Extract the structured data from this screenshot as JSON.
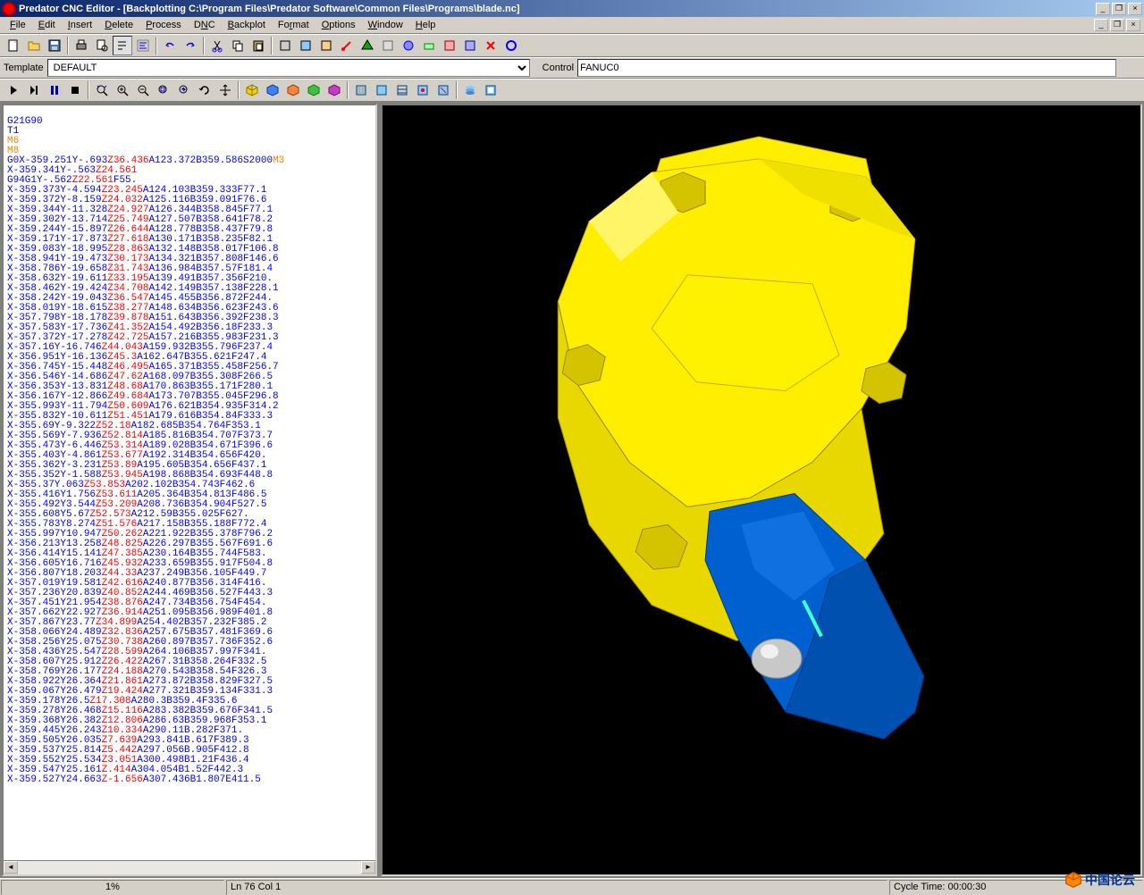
{
  "title": "Predator CNC Editor - [Backplotting C:\\Program Files\\Predator Software\\Common Files\\Programs\\blade.nc]",
  "menu": {
    "file": "File",
    "edit": "Edit",
    "insert": "Insert",
    "delete": "Delete",
    "process": "Process",
    "dnc": "DNC",
    "backplot": "Backplot",
    "format": "Format",
    "options": "Options",
    "window": "Window",
    "help": "Help"
  },
  "template_label": "Template",
  "template_value": "DEFAULT",
  "control_label": "Control",
  "control_value": "FANUC0",
  "status": {
    "progress": "1%",
    "position": "Ln 76 Col 1",
    "cycle": "Cycle Time:  00:00:30"
  },
  "code": {
    "l1": "G21G90",
    "l2": "T1",
    "l3": "M6",
    "l4": "M8",
    "l5a": "G0X-359.251Y-.693",
    "l5b": "Z36.436",
    "l5c": "A123.372B359.586S2000",
    "l5d": "M3",
    "l6a": "X-359.341Y-.563",
    "l6b": "Z24.561",
    "l7a": "G94G1Y-.562",
    "l7b": "Z22.561",
    "l7c": "F55.",
    "l8a": "X-359.373Y-4.594",
    "l8b": "Z23.245",
    "l8c": "A124.103B359.333F77.1",
    "l9a": "X-359.372Y-8.159",
    "l9b": "Z24.032",
    "l9c": "A125.116B359.091F76.6",
    "l10a": "X-359.344Y-11.328",
    "l10b": "Z24.927",
    "l10c": "A126.344B358.845F77.1",
    "l11a": "X-359.302Y-13.714",
    "l11b": "Z25.749",
    "l11c": "A127.507B358.641F78.2",
    "l12a": "X-359.244Y-15.897",
    "l12b": "Z26.644",
    "l12c": "A128.778B358.437F79.8",
    "l13a": "X-359.171Y-17.873",
    "l13b": "Z27.618",
    "l13c": "A130.171B358.235F82.1",
    "l14a": "X-359.083Y-18.995",
    "l14b": "Z28.863",
    "l14c": "A132.148B358.017F106.8",
    "l15a": "X-358.941Y-19.473",
    "l15b": "Z30.173",
    "l15c": "A134.321B357.808F146.6",
    "l16a": "X-358.786Y-19.658",
    "l16b": "Z31.743",
    "l16c": "A136.984B357.57F181.4",
    "l17a": "X-358.632Y-19.611",
    "l17b": "Z33.195",
    "l17c": "A139.491B357.356F210.",
    "l18a": "X-358.462Y-19.424",
    "l18b": "Z34.708",
    "l18c": "A142.149B357.138F228.1",
    "l19a": "X-358.242Y-19.043",
    "l19b": "Z36.547",
    "l19c": "A145.455B356.872F244.",
    "l20a": "X-358.019Y-18.615",
    "l20b": "Z38.277",
    "l20c": "A148.634B356.623F243.6",
    "l21a": "X-357.798Y-18.178",
    "l21b": "Z39.878",
    "l21c": "A151.643B356.392F238.3",
    "l22a": "X-357.583Y-17.736",
    "l22b": "Z41.352",
    "l22c": "A154.492B356.18F233.3",
    "l23a": "X-357.372Y-17.278",
    "l23b": "Z42.725",
    "l23c": "A157.216B355.983F231.3",
    "l24a": "X-357.16Y-16.746",
    "l24b": "Z44.043",
    "l24c": "A159.932B355.796F237.4",
    "l25a": "X-356.951Y-16.136",
    "l25b": "Z45.3",
    "l25c": "A162.647B355.621F247.4",
    "l26a": "X-356.745Y-15.448",
    "l26b": "Z46.495",
    "l26c": "A165.371B355.458F256.7",
    "l27a": "X-356.546Y-14.686",
    "l27b": "Z47.62",
    "l27c": "A168.097B355.308F266.5",
    "l28a": "X-356.353Y-13.831",
    "l28b": "Z48.68",
    "l28c": "A170.863B355.171F280.1",
    "l29a": "X-356.167Y-12.866",
    "l29b": "Z49.684",
    "l29c": "A173.707B355.045F296.8",
    "l30a": "X-355.993Y-11.794",
    "l30b": "Z50.609",
    "l30c": "A176.621B354.935F314.2",
    "l31a": "X-355.832Y-10.611",
    "l31b": "Z51.451",
    "l31c": "A179.616B354.84F333.3",
    "l32a": "X-355.69Y-9.322",
    "l32b": "Z52.18",
    "l32c": "A182.685B354.764F353.1",
    "l33a": "X-355.569Y-7.936",
    "l33b": "Z52.814",
    "l33c": "A185.816B354.707F373.7",
    "l34a": "X-355.473Y-6.446",
    "l34b": "Z53.314",
    "l34c": "A189.028B354.671F396.6",
    "l35a": "X-355.403Y-4.861",
    "l35b": "Z53.677",
    "l35c": "A192.314B354.656F420.",
    "l36a": "X-355.362Y-3.231",
    "l36b": "Z53.89",
    "l36c": "A195.605B354.656F437.1",
    "l37a": "X-355.352Y-1.588",
    "l37b": "Z53.945",
    "l37c": "A198.868B354.693F448.8",
    "l38a": "X-355.37Y.063",
    "l38b": "Z53.853",
    "l38c": "A202.102B354.743F462.6",
    "l39a": "X-355.416Y1.756",
    "l39b": "Z53.611",
    "l39c": "A205.364B354.813F486.5",
    "l40a": "X-355.492Y3.544",
    "l40b": "Z53.209",
    "l40c": "A208.736B354.904F527.5",
    "l41a": "X-355.608Y5.67",
    "l41b": "Z52.573",
    "l41c": "A212.59B355.025F627.",
    "l42a": "X-355.783Y8.274",
    "l42b": "Z51.576",
    "l42c": "A217.158B355.188F772.4",
    "l43a": "X-355.997Y10.947",
    "l43b": "Z50.262",
    "l43c": "A221.922B355.378F796.2",
    "l44a": "X-356.213Y13.258",
    "l44b": "Z48.825",
    "l44c": "A226.297B355.567F691.6",
    "l45a": "X-356.414Y15.141",
    "l45b": "Z47.385",
    "l45c": "A230.164B355.744F583.",
    "l46a": "X-356.605Y16.716",
    "l46b": "Z45.932",
    "l46c": "A233.659B355.917F504.8",
    "l47a": "X-356.807Y18.203",
    "l47b": "Z44.33",
    "l47c": "A237.249B356.105F449.7",
    "l48a": "X-357.019Y19.581",
    "l48b": "Z42.616",
    "l48c": "A240.877B356.314F416.",
    "l49a": "X-357.236Y20.839",
    "l49b": "Z40.852",
    "l49c": "A244.469B356.527F443.3",
    "l50a": "X-357.451Y21.954",
    "l50b": "Z38.876",
    "l50c": "A247.734B356.754F454.",
    "l51a": "X-357.662Y22.927",
    "l51b": "Z36.914",
    "l51c": "A251.095B356.989F401.8",
    "l52a": "X-357.867Y23.77",
    "l52b": "Z34.899",
    "l52c": "A254.402B357.232F385.2",
    "l53a": "X-358.066Y24.489",
    "l53b": "Z32.836",
    "l53c": "A257.675B357.481F369.6",
    "l54a": "X-358.256Y25.075",
    "l54b": "Z30.738",
    "l54c": "A260.897B357.736F352.6",
    "l55a": "X-358.436Y25.547",
    "l55b": "Z28.599",
    "l55c": "A264.106B357.997F341.",
    "l56a": "X-358.607Y25.912",
    "l56b": "Z26.422",
    "l56c": "A267.31B358.264F332.5",
    "l57a": "X-358.769Y26.177",
    "l57b": "Z24.188",
    "l57c": "A270.543B358.54F326.3",
    "l58a": "X-358.922Y26.364",
    "l58b": "Z21.861",
    "l58c": "A273.872B358.829F327.5",
    "l59a": "X-359.067Y26.479",
    "l59b": "Z19.424",
    "l59c": "A277.321B359.134F331.3",
    "l60a": "X-359.178Y26.5",
    "l60b": "Z17.308",
    "l60c": "A280.3B359.4F335.6",
    "l61a": "X-359.278Y26.468",
    "l61b": "Z15.116",
    "l61c": "A283.382B359.676F341.5",
    "l62a": "X-359.368Y26.382",
    "l62b": "Z12.806",
    "l62c": "A286.63B359.968F353.1",
    "l63a": "X-359.445Y26.243",
    "l63b": "Z10.334",
    "l63c": "A290.11B.282F371.",
    "l64a": "X-359.505Y26.035",
    "l64b": "Z7.639",
    "l64c": "A293.841B.617F389.3",
    "l65a": "X-359.537Y25.814",
    "l65b": "Z5.442",
    "l65c": "A297.056B.905F412.8",
    "l66a": "X-359.552Y25.534",
    "l66b": "Z3.051",
    "l66c": "A300.498B1.21F436.4",
    "l67a": "X-359.547Y25.161",
    "l67b": "Z.414",
    "l67c": "A304.054B1.52F442.3",
    "l68a": "X-359.527Y24.663",
    "l68b": "Z-1.656",
    "l68c": "A307.436B1.807E411.5"
  }
}
